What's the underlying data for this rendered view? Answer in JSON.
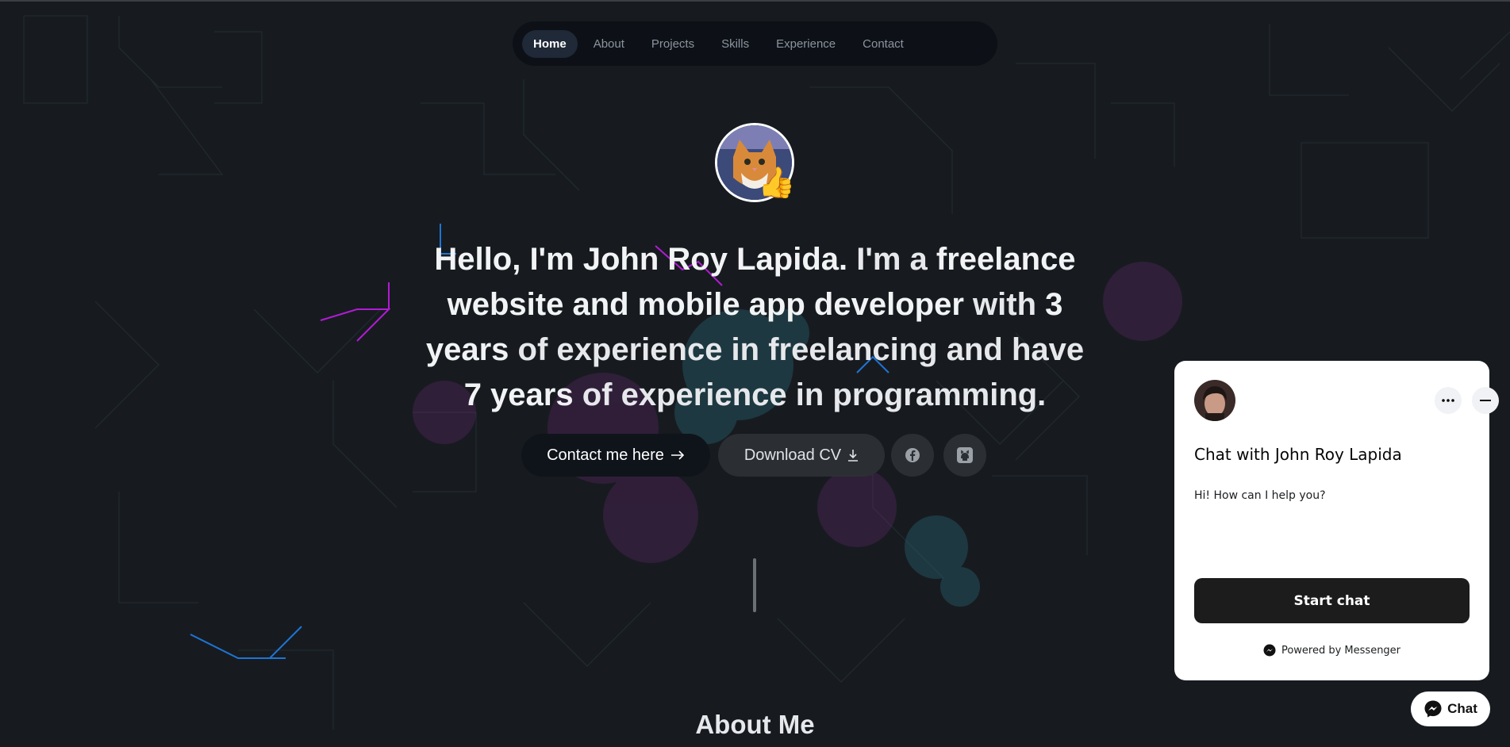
{
  "nav": {
    "items": [
      {
        "label": "Home",
        "active": true
      },
      {
        "label": "About",
        "active": false
      },
      {
        "label": "Projects",
        "active": false
      },
      {
        "label": "Skills",
        "active": false
      },
      {
        "label": "Experience",
        "active": false
      },
      {
        "label": "Contact",
        "active": false
      }
    ]
  },
  "hero": {
    "avatar_icon": "cat-avatar-icon",
    "badge_icon": "thumbs-up-icon",
    "parts": {
      "p1": "Hello, I'm John Roy Lapida.",
      "p2": " I'm a ",
      "p3": "freelance website and mobile app developer",
      "p4": " with ",
      "p5": "3 years",
      "p6": " of experience in freelancing and have ",
      "p7": "7 years",
      "p8": " of experience in programming."
    }
  },
  "actions": {
    "contact_label": "Contact me here",
    "cv_label": "Download CV",
    "contact_icon": "arrow-right-icon",
    "cv_icon": "download-icon",
    "facebook_icon": "facebook-icon",
    "github_icon": "github-icon"
  },
  "about": {
    "title": "About Me"
  },
  "chat": {
    "title": "Chat with John Roy Lapida",
    "greeting": "Hi! How can I help you?",
    "start_label": "Start chat",
    "powered_by": "Powered by Messenger",
    "pill_label": "Chat"
  },
  "colors": {
    "background": "#171b1f",
    "nav_bg": "#0d1117",
    "nav_active": "#1f2937",
    "accent_magenta": "#b21ad6",
    "accent_blue": "#1e74d6",
    "accent_teal": "#2a7a86"
  }
}
